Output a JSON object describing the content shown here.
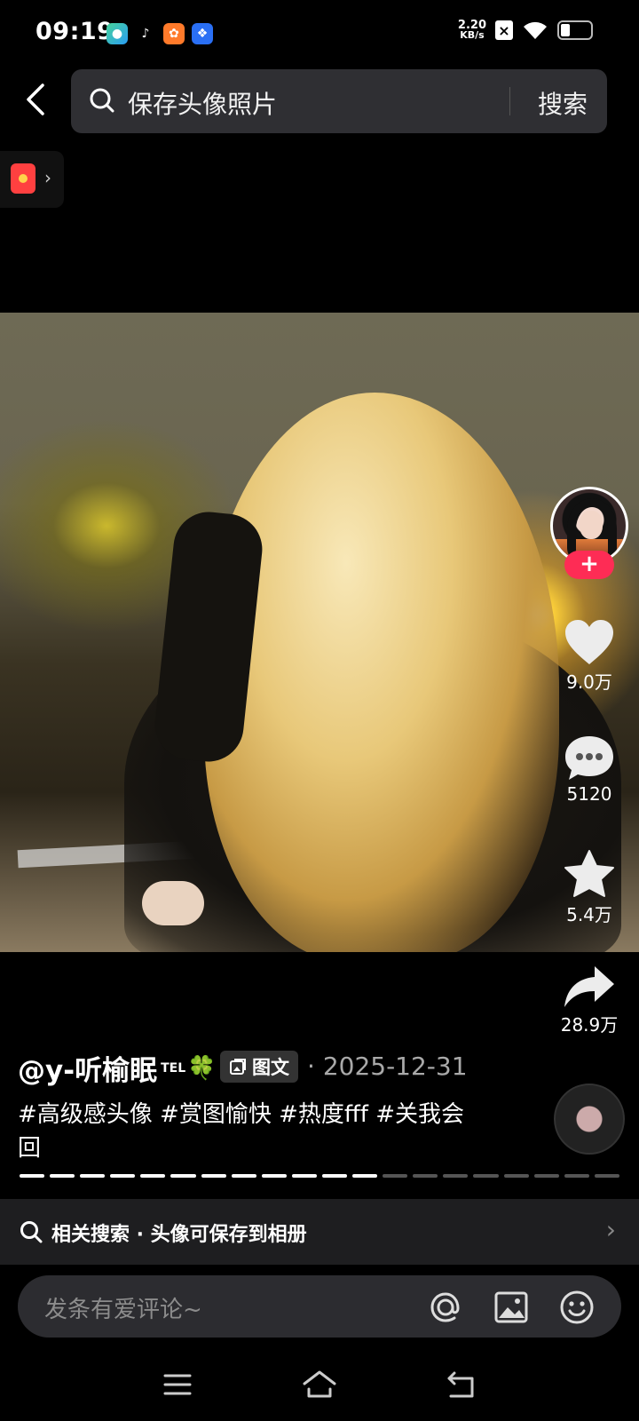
{
  "status_bar": {
    "time": "09:19",
    "net_speed_value": "2.20",
    "net_speed_unit": "KB/s",
    "app_icons": [
      "green-app-icon",
      "tiktok-icon",
      "orange-app-icon",
      "baidu-icon"
    ]
  },
  "header": {
    "back_icon": "chevron-left-icon",
    "search_query": "保存头像照片",
    "search_button": "搜索"
  },
  "red_packet": {
    "icon": "red-envelope-icon"
  },
  "side_actions": {
    "like_count": "9.0万",
    "comment_count": "5120",
    "favorite_count": "5.4万",
    "share_count": "28.9万"
  },
  "post": {
    "author": "@y-听榆眠",
    "author_badge": "TEL",
    "author_emoji": "🍀",
    "type_tag": "图文",
    "date_separator": "·",
    "date": "2025-12-31",
    "caption": "#高级感头像 #赏图愉快 #热度fff #关我会回"
  },
  "pager": {
    "total": 20,
    "active_through": 12
  },
  "related_search": {
    "label": "相关搜索 · 头像可保存到相册"
  },
  "comment_bar": {
    "placeholder": "发条有爱评论~"
  },
  "colors": {
    "accent": "#fe2c55",
    "background": "#000000",
    "search_bg": "#2f2f33"
  }
}
